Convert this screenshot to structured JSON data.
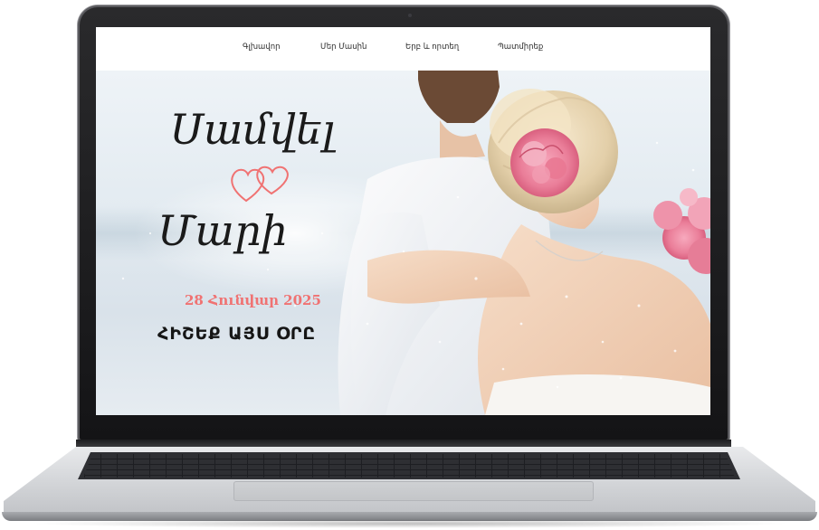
{
  "nav": {
    "items": [
      {
        "label": "Գլխավոր"
      },
      {
        "label": "Մեր Մասին"
      },
      {
        "label": "Երբ և որտեղ"
      },
      {
        "label": "Պատմիրեք"
      }
    ]
  },
  "hero": {
    "name_1": "Սամվել",
    "name_2": "Մարի",
    "date": "28 Հունվար 2025",
    "tagline": "ՀԻՇԵՔ ԱՅՍ ՕՐԸ",
    "hearts_icon": "double-heart-icon"
  },
  "colors": {
    "accent": "#f07272",
    "text": "#161616",
    "nav_bg": "#ffffff"
  }
}
